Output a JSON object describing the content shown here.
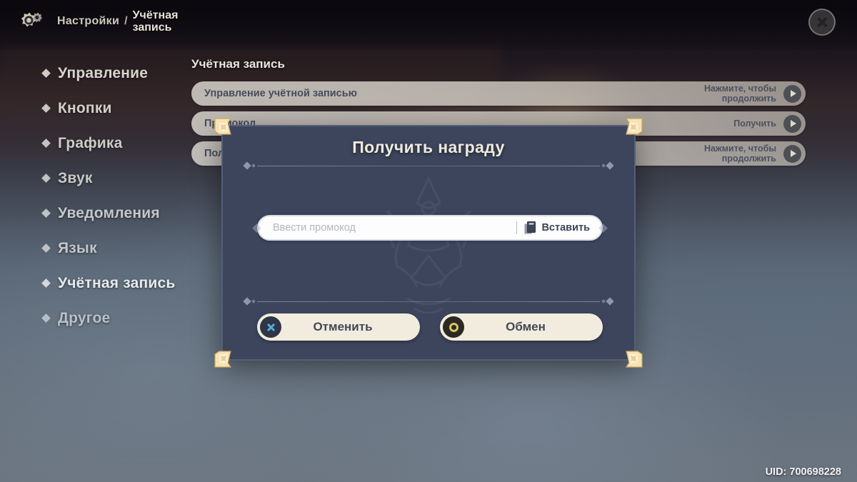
{
  "header": {
    "gear_icon": "gear-icon",
    "breadcrumb_root": "Настройки",
    "breadcrumb_separator": "/",
    "breadcrumb_current": "Учётная запись",
    "close_icon": "close-icon"
  },
  "sidebar": {
    "items": [
      {
        "label": "Управление",
        "active": false
      },
      {
        "label": "Кнопки",
        "active": false
      },
      {
        "label": "Графика",
        "active": false
      },
      {
        "label": "Звук",
        "active": false
      },
      {
        "label": "Уведомления",
        "active": false
      },
      {
        "label": "Язык",
        "active": false
      },
      {
        "label": "Учётная запись",
        "active": true
      },
      {
        "label": "Другое",
        "active": false
      }
    ]
  },
  "content": {
    "title": "Учётная запись",
    "rows": [
      {
        "label": "Управление учётной записью",
        "action": "Нажмите, чтобы\nпродолжить"
      },
      {
        "label": "Промокод",
        "action": "Получить"
      },
      {
        "label": "Получить награду",
        "action": "Нажмите, чтобы\nпродолжить"
      }
    ]
  },
  "modal": {
    "title": "Получить награду",
    "input_placeholder": "Ввести промокод",
    "input_value": "",
    "paste_label": "Вставить",
    "paste_icon": "clipboard-icon",
    "cancel_label": "Отменить",
    "cancel_icon": "close-circle-icon",
    "confirm_label": "Обмен",
    "confirm_icon": "confirm-circle-icon"
  },
  "footer": {
    "uid": "UID: 700698228"
  },
  "colors": {
    "modal_bg": "#3c455c",
    "modal_border": "#555f78",
    "button_bg": "#f2ecde",
    "accent_gold": "#d9c26a",
    "accent_blue": "#5aa9d6",
    "corner_gold": "#f6e2b0"
  }
}
